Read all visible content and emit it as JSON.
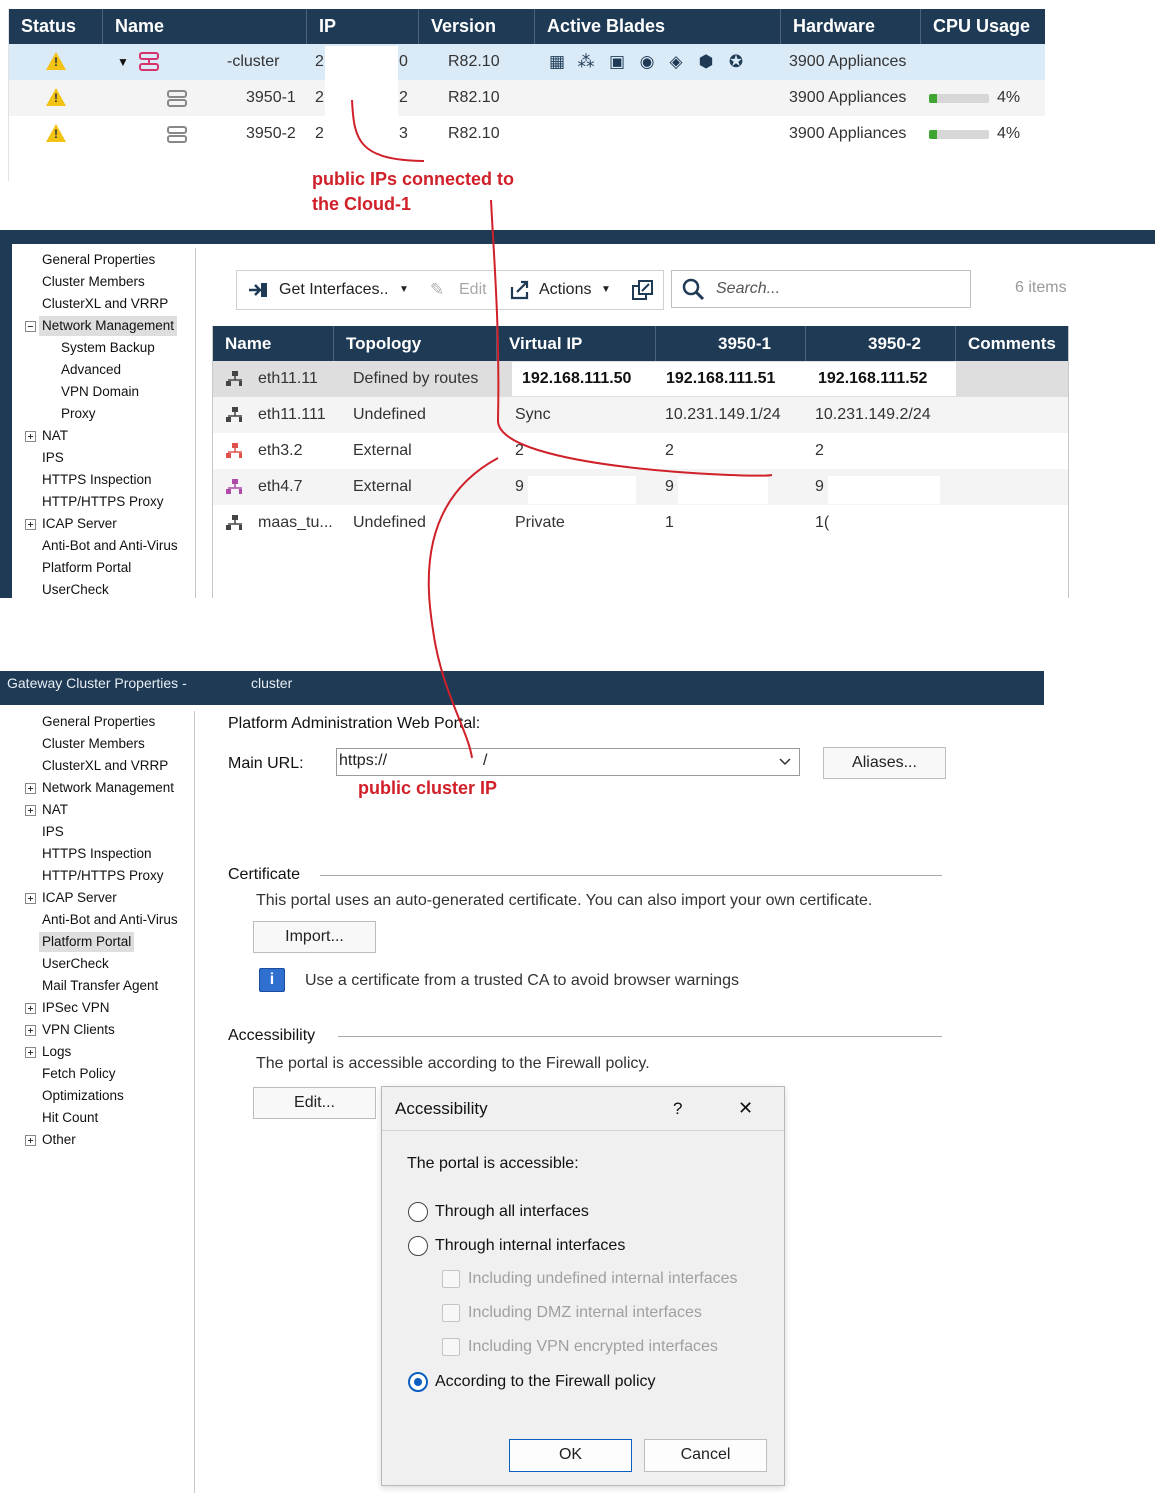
{
  "gateways": {
    "columns": [
      "Status",
      "Name",
      "IP",
      "Version",
      "Active Blades",
      "Hardware",
      "CPU Usage"
    ],
    "rows": [
      {
        "name": "-cluster",
        "ip_start": "2",
        "ip_end": "0",
        "version": "R82.10",
        "hardware": "3900 Appliances",
        "cpu": "",
        "cpu_fraction": null
      },
      {
        "name": "3950-1",
        "ip_start": "2",
        "ip_end": "2",
        "version": "R82.10",
        "hardware": "3900 Appliances",
        "cpu": "4%",
        "cpu_fraction": 0.04
      },
      {
        "name": "3950-2",
        "ip_start": "2",
        "ip_end": "3",
        "version": "R82.10",
        "hardware": "3900 Appliances",
        "cpu": "4%",
        "cpu_fraction": 0.04
      }
    ],
    "status_icon": "warning-icon",
    "blade_icons": [
      "firewall-icon",
      "network-icon",
      "application-icon",
      "url-filtering-icon",
      "ips-icon",
      "anti-bot-icon",
      "anti-virus-icon"
    ],
    "selected_row_color": "#dbeaf7"
  },
  "annotations": {
    "public_ips": [
      "public IPs connected to",
      "the Cloud-1"
    ],
    "public_cluster_ip": "public cluster IP",
    "color": "#d0202a"
  },
  "network_window": {
    "nav": [
      {
        "label": "General Properties"
      },
      {
        "label": "Cluster Members"
      },
      {
        "label": "ClusterXL and VRRP"
      },
      {
        "label": "Network Management",
        "expanded": true,
        "selected": true
      },
      {
        "label": "System Backup",
        "child": true
      },
      {
        "label": "Advanced",
        "child": true
      },
      {
        "label": "VPN Domain",
        "child": true
      },
      {
        "label": "Proxy",
        "child": true
      },
      {
        "label": "NAT",
        "expander": true
      },
      {
        "label": "IPS"
      },
      {
        "label": "HTTPS Inspection"
      },
      {
        "label": "HTTP/HTTPS Proxy"
      },
      {
        "label": "ICAP Server",
        "expander": true
      },
      {
        "label": "Anti-Bot and Anti-Virus"
      },
      {
        "label": "Platform Portal"
      },
      {
        "label": "UserCheck"
      }
    ],
    "toolbar": {
      "get_interfaces": "Get Interfaces..",
      "edit": "Edit",
      "actions": "Actions"
    },
    "search_placeholder": "Search...",
    "items_count": "6 items",
    "columns": [
      "Name",
      "Topology",
      "Virtual IP",
      "3950-1",
      "3950-2",
      "Comments"
    ],
    "rows": [
      {
        "name": "eth11.11",
        "topology": "Defined by routes",
        "vip": "192.168.111.50",
        "m1": "192.168.111.51",
        "m2": "192.168.111.52",
        "comments": "",
        "icon_color": "#444444"
      },
      {
        "name": "eth11.111",
        "topology": "Undefined",
        "vip": "Sync",
        "m1": "10.231.149.1/24",
        "m2": "10.231.149.2/24",
        "comments": "",
        "icon_color": "#444444"
      },
      {
        "name": "eth3.2",
        "topology": "External",
        "vip": "2",
        "m1": "2",
        "m2": "2",
        "comments": "",
        "icon_color": "#e0504a"
      },
      {
        "name": "eth4.7",
        "topology": "External",
        "vip": "9",
        "m1": "9",
        "m2": "9",
        "comments": "",
        "icon_color": "#b04aa8"
      },
      {
        "name": "maas_tu...",
        "topology": "Undefined",
        "vip": "Private",
        "m1": "1",
        "m2": "1(",
        "comments": "",
        "icon_color": "#444444"
      }
    ]
  },
  "portal_window": {
    "title": "Gateway Cluster Properties -",
    "title_suffix": "cluster",
    "nav": [
      {
        "label": "General Properties"
      },
      {
        "label": "Cluster Members"
      },
      {
        "label": "ClusterXL and VRRP"
      },
      {
        "label": "Network Management",
        "expander": true
      },
      {
        "label": "NAT",
        "expander": true
      },
      {
        "label": "IPS"
      },
      {
        "label": "HTTPS Inspection"
      },
      {
        "label": "HTTP/HTTPS Proxy"
      },
      {
        "label": "ICAP Server",
        "expander": true
      },
      {
        "label": "Anti-Bot and Anti-Virus"
      },
      {
        "label": "Platform Portal",
        "selected": true
      },
      {
        "label": "UserCheck"
      },
      {
        "label": "Mail Transfer Agent"
      },
      {
        "label": "IPSec VPN",
        "expander": true
      },
      {
        "label": "VPN Clients",
        "expander": true
      },
      {
        "label": "Logs",
        "expander": true
      },
      {
        "label": "Fetch Policy"
      },
      {
        "label": "Optimizations"
      },
      {
        "label": "Hit Count"
      },
      {
        "label": "Other",
        "expander": true
      }
    ],
    "heading": "Platform Administration Web Portal:",
    "main_url_label": "Main URL:",
    "main_url_value": "https://",
    "main_url_tail": "/",
    "aliases_button": "Aliases...",
    "certificate": {
      "title": "Certificate",
      "text": "This portal uses an auto-generated certificate. You can also import your own certificate.",
      "import_button": "Import...",
      "info": "Use a certificate from a trusted CA to avoid browser warnings"
    },
    "accessibility": {
      "title": "Accessibility",
      "text": "The portal is accessible according to the Firewall policy.",
      "edit_button": "Edit..."
    }
  },
  "dialog": {
    "title": "Accessibility",
    "help": "?",
    "close": "✕",
    "label": "The portal is accessible:",
    "options": [
      {
        "label": "Through all interfaces",
        "checked": false
      },
      {
        "label": "Through internal interfaces",
        "checked": false
      },
      {
        "label": "According to the Firewall policy",
        "checked": true
      }
    ],
    "suboptions": [
      {
        "label": "Including undefined internal interfaces",
        "checked": false,
        "disabled": true
      },
      {
        "label": "Including DMZ internal interfaces",
        "checked": false,
        "disabled": true
      },
      {
        "label": "Including VPN encrypted interfaces",
        "checked": false,
        "disabled": true
      }
    ],
    "ok": "OK",
    "cancel": "Cancel"
  }
}
